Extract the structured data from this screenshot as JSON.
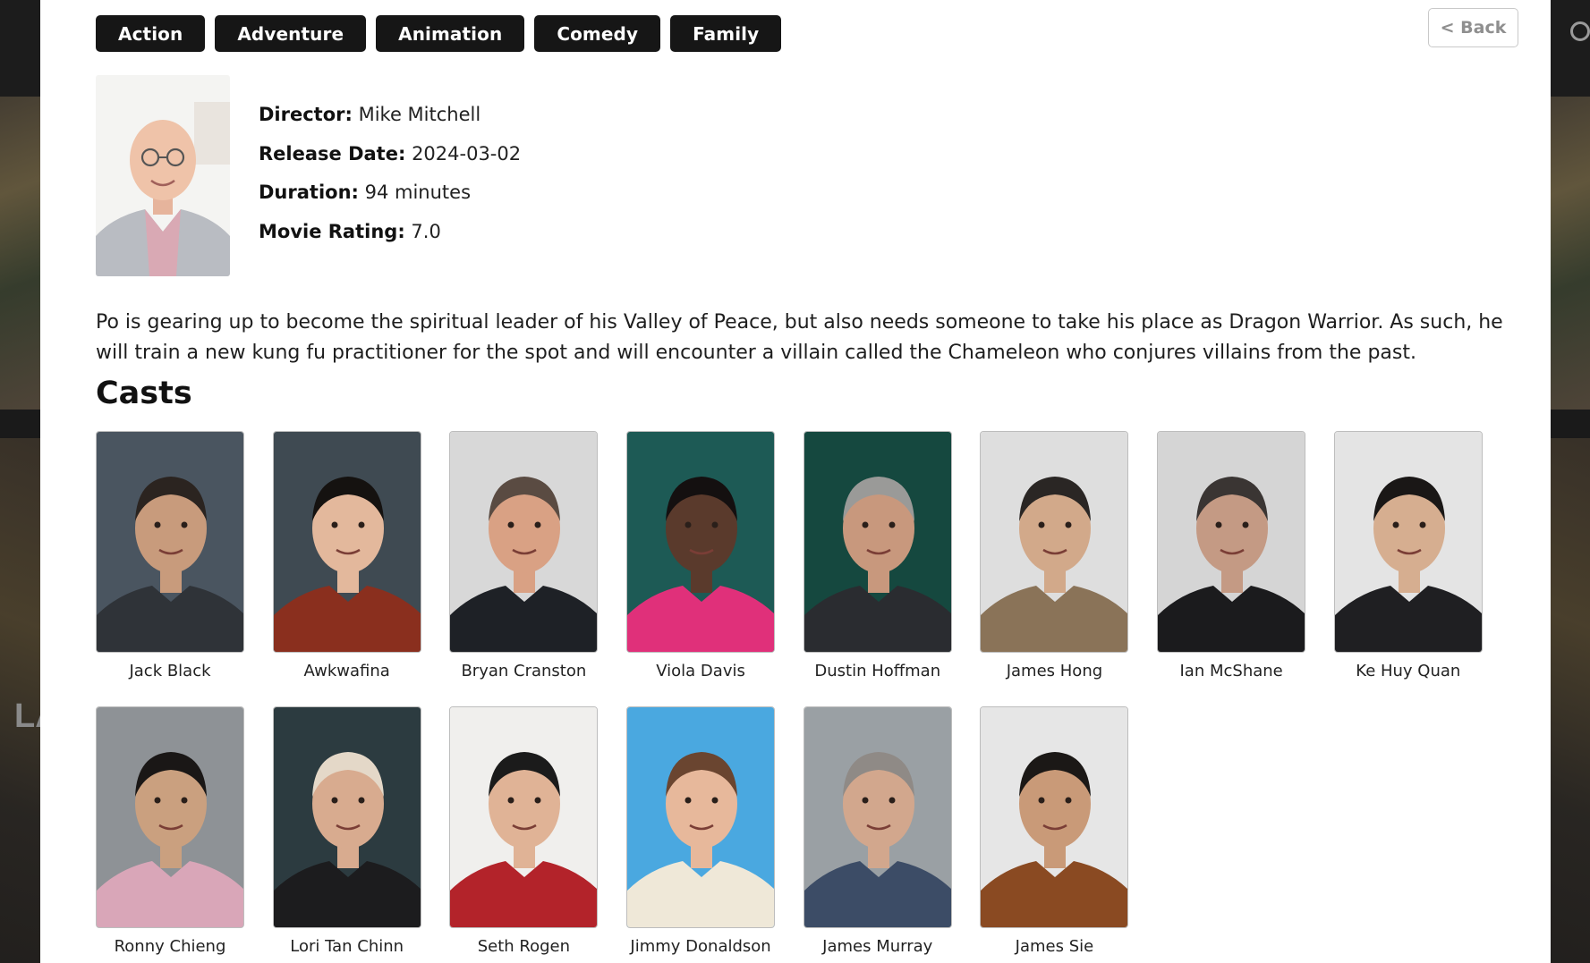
{
  "genres": [
    "Action",
    "Adventure",
    "Animation",
    "Comedy",
    "Family"
  ],
  "back_label": "< Back",
  "director": {
    "label": "Director:",
    "value": "Mike Mitchell",
    "photo_bg": "#ffffff"
  },
  "facts": {
    "release_label": "Release Date:",
    "release_value": "2024-03-02",
    "duration_label": "Duration:",
    "duration_value": "94 minutes",
    "rating_label": "Movie Rating:",
    "rating_value": "7.0"
  },
  "overview": "Po is gearing up to become the spiritual leader of his Valley of Peace, but also needs someone to take his place as Dragon Warrior. As such, he will train a new kung fu practitioner for the spot and will encounter a villain called the Chameleon who conjures villains from the past.",
  "casts_title": "Casts",
  "cast": [
    {
      "name": "Jack Black",
      "bg": "#4a5560",
      "skin": "#c89b7c",
      "hair": "#2b2420",
      "shirt": "#2f3338"
    },
    {
      "name": "Awkwafina",
      "bg": "#3f4a52",
      "skin": "#e3b89c",
      "hair": "#151210",
      "shirt": "#8a2f1e"
    },
    {
      "name": "Bryan Cranston",
      "bg": "#d8d8d8",
      "skin": "#d9a184",
      "hair": "#5a4b42",
      "shirt": "#1e2126"
    },
    {
      "name": "Viola Davis",
      "bg": "#1d5a55",
      "skin": "#5a3a2c",
      "hair": "#141010",
      "shirt": "#e0307a"
    },
    {
      "name": "Dustin Hoffman",
      "bg": "#15483f",
      "skin": "#c8987d",
      "hair": "#9a9a98",
      "shirt": "#2a2c30"
    },
    {
      "name": "James Hong",
      "bg": "#dedede",
      "skin": "#d2a98a",
      "hair": "#2a2624",
      "shirt": "#8a7358"
    },
    {
      "name": "Ian McShane",
      "bg": "#d5d5d5",
      "skin": "#c49a84",
      "hair": "#3a3533",
      "shirt": "#1b1b1d"
    },
    {
      "name": "Ke Huy Quan",
      "bg": "#e4e4e4",
      "skin": "#d6ae90",
      "hair": "#1a1716",
      "shirt": "#1f1f22"
    },
    {
      "name": "Ronny Chieng",
      "bg": "#8e9296",
      "skin": "#caa07f",
      "hair": "#1a1716",
      "shirt": "#d9a6b8"
    },
    {
      "name": "Lori Tan Chinn",
      "bg": "#2c3b40",
      "skin": "#d8ab8f",
      "hair": "#e4d8c8",
      "shirt": "#1c1c1e"
    },
    {
      "name": "Seth Rogen",
      "bg": "#f0efed",
      "skin": "#e0b396",
      "hair": "#1b1b1b",
      "shirt": "#b3232a"
    },
    {
      "name": "Jimmy Donaldson",
      "bg": "#4aa8e0",
      "skin": "#e7b89b",
      "hair": "#6a4530",
      "shirt": "#efe8d8"
    },
    {
      "name": "James Murray",
      "bg": "#9aa0a4",
      "skin": "#d2a78d",
      "hair": "#8f8a86",
      "shirt": "#3c4c66"
    },
    {
      "name": "James Sie",
      "bg": "#e6e6e6",
      "skin": "#c99a78",
      "hair": "#1b1816",
      "shirt": "#8a4a22"
    }
  ]
}
